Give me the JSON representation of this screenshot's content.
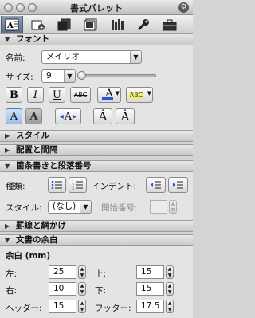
{
  "window": {
    "title": "書式パレット"
  },
  "toolbar": {
    "tabs": [
      {
        "icon": "format-text-icon",
        "active": true
      },
      {
        "icon": "insert-object-icon"
      },
      {
        "icon": "copy-pages-icon"
      },
      {
        "icon": "gallery-icon"
      },
      {
        "icon": "library-icon"
      },
      {
        "icon": "wrench-icon"
      },
      {
        "icon": "toolbox-icon"
      }
    ]
  },
  "font": {
    "section_label": "フォント",
    "name_label": "名前:",
    "name_value": "メイリオ",
    "size_label": "サイズ:",
    "size_value": "9",
    "style_buttons": [
      "B",
      "I",
      "U",
      "ABC"
    ],
    "font_color_glyph": "A",
    "highlight_glyph": "ABC",
    "effect_buttons": [
      "A",
      "A",
      "A"
    ],
    "case_buttons": [
      "Ȧ",
      "Ȧ"
    ]
  },
  "style": {
    "section_label": "スタイル"
  },
  "alignment": {
    "section_label": "配置と間隔"
  },
  "bullets": {
    "section_label": "箇条書きと段落番号",
    "type_label": "種類:",
    "indent_label": "インデント:",
    "style_label": "スタイル:",
    "style_value": "(なし)",
    "start_label": "開始番号:"
  },
  "borders": {
    "section_label": "罫線と網かけ"
  },
  "margins": {
    "section_label": "文書の余白",
    "heading": "余白 (mm)",
    "left_label": "左:",
    "left_value": "25",
    "top_label": "上:",
    "top_value": "15",
    "right_label": "右:",
    "right_value": "10",
    "bottom_label": "下:",
    "bottom_value": "15",
    "header_label": "ヘッダー:",
    "header_value": "15",
    "footer_label": "フッター:",
    "footer_value": "17.5"
  }
}
